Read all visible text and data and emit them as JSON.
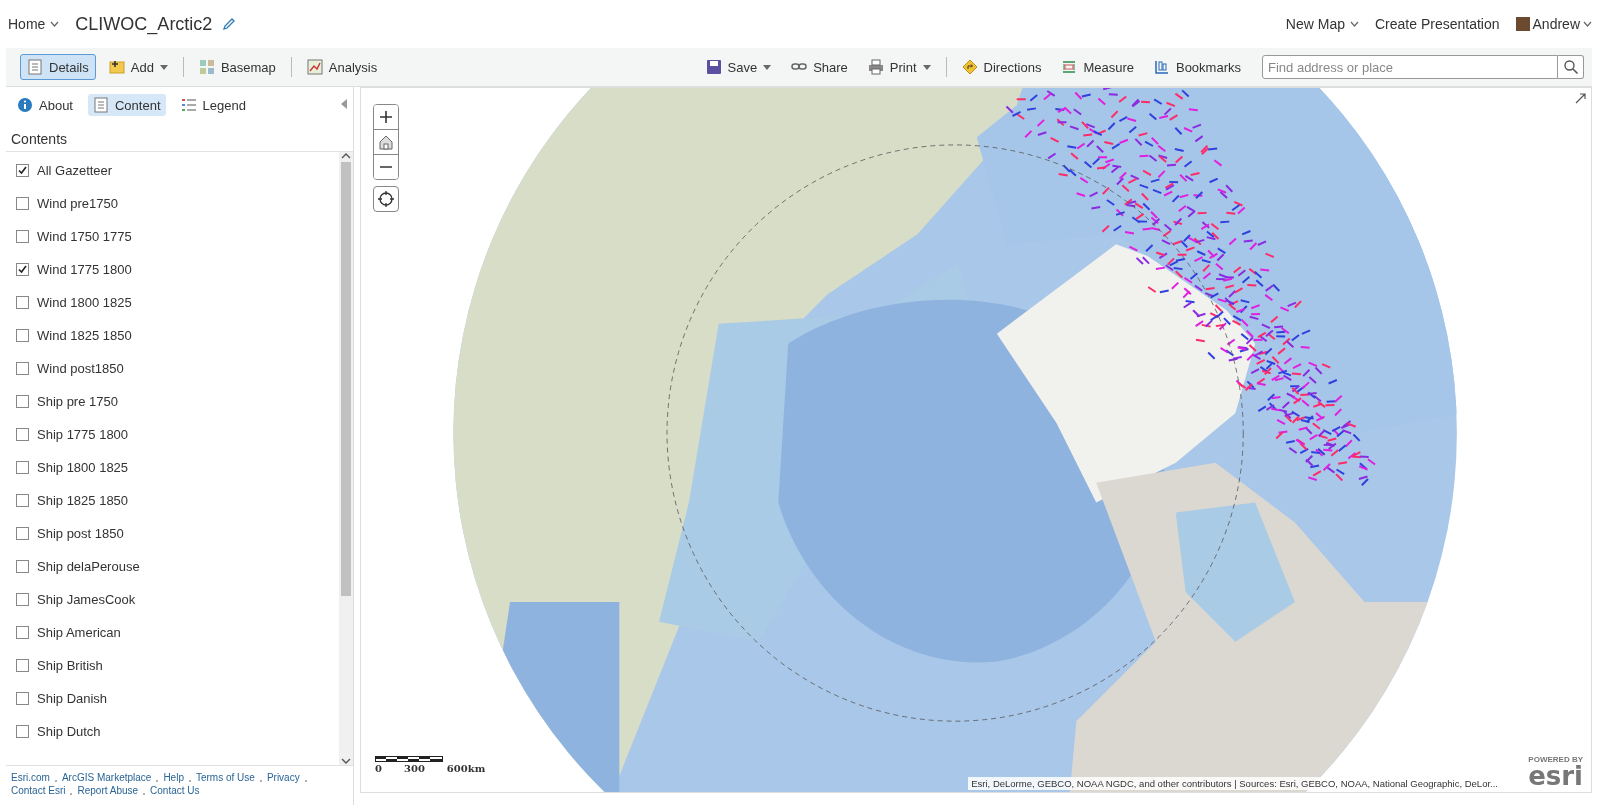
{
  "header": {
    "home": "Home",
    "title": "CLIWOC_Arctic2",
    "new_map": "New Map",
    "create_presentation": "Create Presentation",
    "user": "Andrew"
  },
  "toolbar": {
    "left": [
      {
        "label": "Details",
        "selected": true,
        "has_menu": false
      },
      {
        "label": "Add",
        "selected": false,
        "has_menu": true
      },
      {
        "label": "Basemap",
        "selected": false,
        "has_menu": false
      },
      {
        "label": "Analysis",
        "selected": false,
        "has_menu": false
      }
    ],
    "right": [
      {
        "label": "Save",
        "has_menu": true
      },
      {
        "label": "Share",
        "has_menu": false
      },
      {
        "label": "Print",
        "has_menu": true
      },
      {
        "label": "Directions",
        "has_menu": false
      },
      {
        "label": "Measure",
        "has_menu": false
      },
      {
        "label": "Bookmarks",
        "has_menu": false
      }
    ],
    "search": {
      "placeholder": "Find address or place"
    }
  },
  "panel_tabs": [
    {
      "label": "About",
      "selected": false
    },
    {
      "label": "Content",
      "selected": true
    },
    {
      "label": "Legend",
      "selected": false
    }
  ],
  "contents": {
    "heading": "Contents",
    "layers": [
      {
        "name": "All Gazetteer",
        "checked": true
      },
      {
        "name": "Wind pre1750",
        "checked": false
      },
      {
        "name": "Wind 1750 1775",
        "checked": false
      },
      {
        "name": "Wind 1775 1800",
        "checked": true
      },
      {
        "name": "Wind 1800 1825",
        "checked": false
      },
      {
        "name": "Wind 1825 1850",
        "checked": false
      },
      {
        "name": "Wind post1850",
        "checked": false
      },
      {
        "name": "Ship pre 1750",
        "checked": false
      },
      {
        "name": "Ship 1775 1800",
        "checked": false
      },
      {
        "name": "Ship 1800 1825",
        "checked": false
      },
      {
        "name": "Ship 1825 1850",
        "checked": false
      },
      {
        "name": "Ship post 1850",
        "checked": false
      },
      {
        "name": "Ship delaPerouse",
        "checked": false
      },
      {
        "name": "Ship JamesCook",
        "checked": false
      },
      {
        "name": "Ship American",
        "checked": false
      },
      {
        "name": "Ship British",
        "checked": false
      },
      {
        "name": "Ship Danish",
        "checked": false
      },
      {
        "name": "Ship Dutch",
        "checked": false
      }
    ]
  },
  "footer_links": [
    "Esri.com",
    "ArcGIS Marketplace",
    "Help",
    "Terms of Use",
    "Privacy",
    "Contact Esri",
    "Report Abuse",
    "Contact Us"
  ],
  "map": {
    "scale_labels": [
      "0",
      "300",
      "600km"
    ],
    "attribution": "Esri, DeLorme, GEBCO, NOAA NGDC, and other contributors | Sources: Esri, GEBCO, NOAA, National Geographic, DeLor...",
    "logo_tagline": "POWERED BY",
    "logo": "esri"
  }
}
